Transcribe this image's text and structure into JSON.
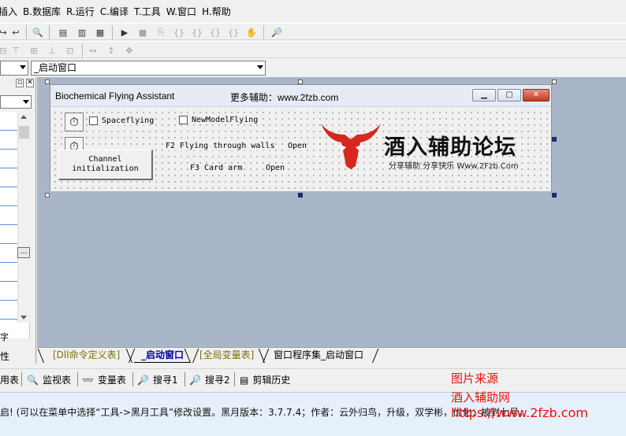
{
  "menu": [
    "插入",
    "B.数据库",
    "R.运行",
    "C.编译",
    "T.工具",
    "W.窗口",
    "H.帮助"
  ],
  "combo": {
    "value": "_启动窗口"
  },
  "left_panel": {
    "bottom_label": "性",
    "row_label": "字"
  },
  "form": {
    "title": "Biochemical Flying Assistant",
    "subtitle": "更多辅助：www.2fzb.com",
    "check_spaceflying": "Spaceflying",
    "check_newmodel": "NewModelFlying",
    "f2_label": "F2 Flying through walls",
    "f2_status": "Open",
    "f3_label": "F3 Card arm",
    "f3_status": "Open",
    "button_line1": "Channel",
    "button_line2": "initialization",
    "timer_glyph": "⏱"
  },
  "logo": {
    "name": "酒入辅助论坛",
    "tagline": "分享辅助 分享快乐 Www.2Fzb.Com"
  },
  "tabs": [
    "[Dll命令定义表]",
    "_启动窗口",
    "[全局变量表]",
    "窗口程序集_启动窗口"
  ],
  "bottom_toolbar": [
    "用表",
    "监视表",
    "变量表",
    "搜寻1",
    "搜寻2",
    "剪辑历史"
  ],
  "status_text": "启!  (可以在菜单中选择“工具->黑月工具”修改设置。黑月版本：3.7.7.4；作者：云外归鸟，升级，双学彬，优化：被封七号。",
  "watermark": {
    "line1": "图片来源",
    "line2": "酒入辅助网",
    "line3": "https://www.2fzb.com"
  },
  "colors": {
    "tab_dll": "#7a7000",
    "tab_active": "#0000aa",
    "tab_global": "#7a7000",
    "logo_red": "#d7281e",
    "watermark_red": "#e8120c"
  }
}
